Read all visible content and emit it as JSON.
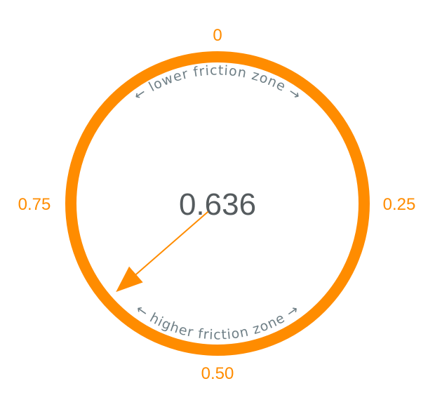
{
  "gauge": {
    "value": 0.636,
    "value_label": "0.636",
    "tick_labels": {
      "top": "0",
      "right": "0.25",
      "bottom": "0.50",
      "left": "0.75"
    },
    "upper_zone_label": "← lower friction zone →",
    "lower_zone_label": "← higher friction zone →",
    "accent_color": "#ff8c00",
    "text_color": "#555b5e",
    "zone_text_color": "#6f7f86"
  }
}
